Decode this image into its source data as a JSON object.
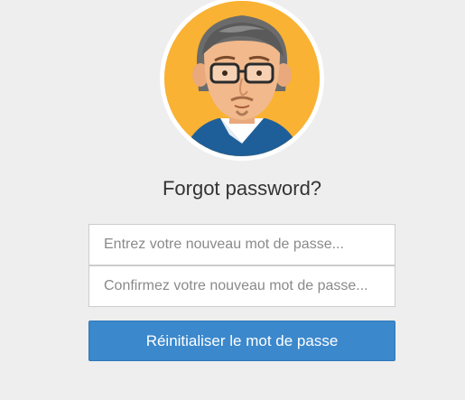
{
  "header": {
    "avatar_icon": "user-avatar-icon",
    "title": "Forgot password?"
  },
  "form": {
    "new_password": {
      "value": "",
      "placeholder": "Entrez votre nouveau mot de passe..."
    },
    "confirm_password": {
      "value": "",
      "placeholder": "Confirmez votre nouveau mot de passe..."
    },
    "reset_button_label": "Réinitialiser le mot de passe"
  },
  "colors": {
    "background": "#eeeeee",
    "avatar_background": "#f9b233",
    "button": "#3b88cc",
    "button_text": "#ffffff",
    "title_text": "#333333"
  }
}
